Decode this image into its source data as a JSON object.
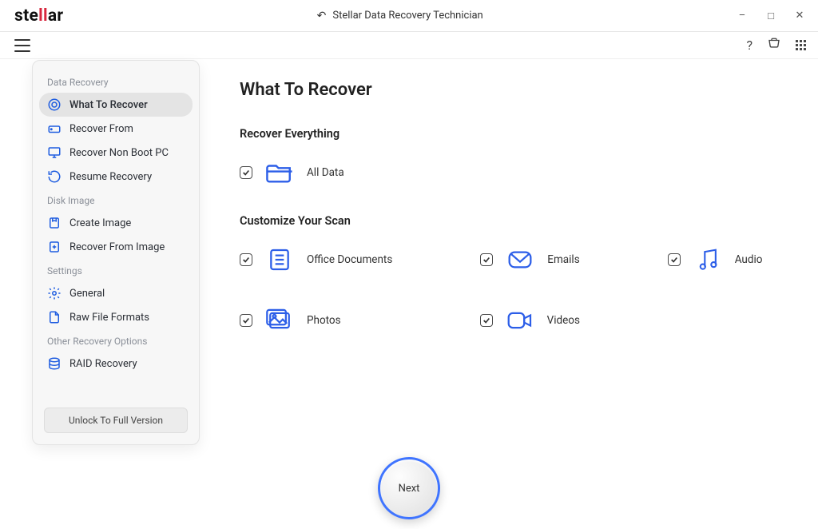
{
  "titlebar": {
    "app_title": "Stellar Data Recovery Technician"
  },
  "toolbar": {
    "help_tooltip": "Help",
    "cart_tooltip": "Buy",
    "apps_tooltip": "More"
  },
  "sidebar": {
    "groups": [
      {
        "title": "Data Recovery",
        "items": [
          {
            "label": "What To Recover",
            "active": true
          },
          {
            "label": "Recover From"
          },
          {
            "label": "Recover Non Boot PC"
          },
          {
            "label": "Resume Recovery"
          }
        ]
      },
      {
        "title": "Disk Image",
        "items": [
          {
            "label": "Create Image"
          },
          {
            "label": "Recover From Image"
          }
        ]
      },
      {
        "title": "Settings",
        "items": [
          {
            "label": "General"
          },
          {
            "label": "Raw File Formats"
          }
        ]
      },
      {
        "title": "Other Recovery Options",
        "items": [
          {
            "label": "RAID Recovery"
          }
        ]
      }
    ],
    "unlock_label": "Unlock To Full Version"
  },
  "main": {
    "title": "What To Recover",
    "section1_title": "Recover Everything",
    "all_data_label": "All Data",
    "section2_title": "Customize Your Scan",
    "options": {
      "office": "Office Documents",
      "emails": "Emails",
      "audio": "Audio",
      "photos": "Photos",
      "videos": "Videos"
    }
  },
  "next_label": "Next"
}
